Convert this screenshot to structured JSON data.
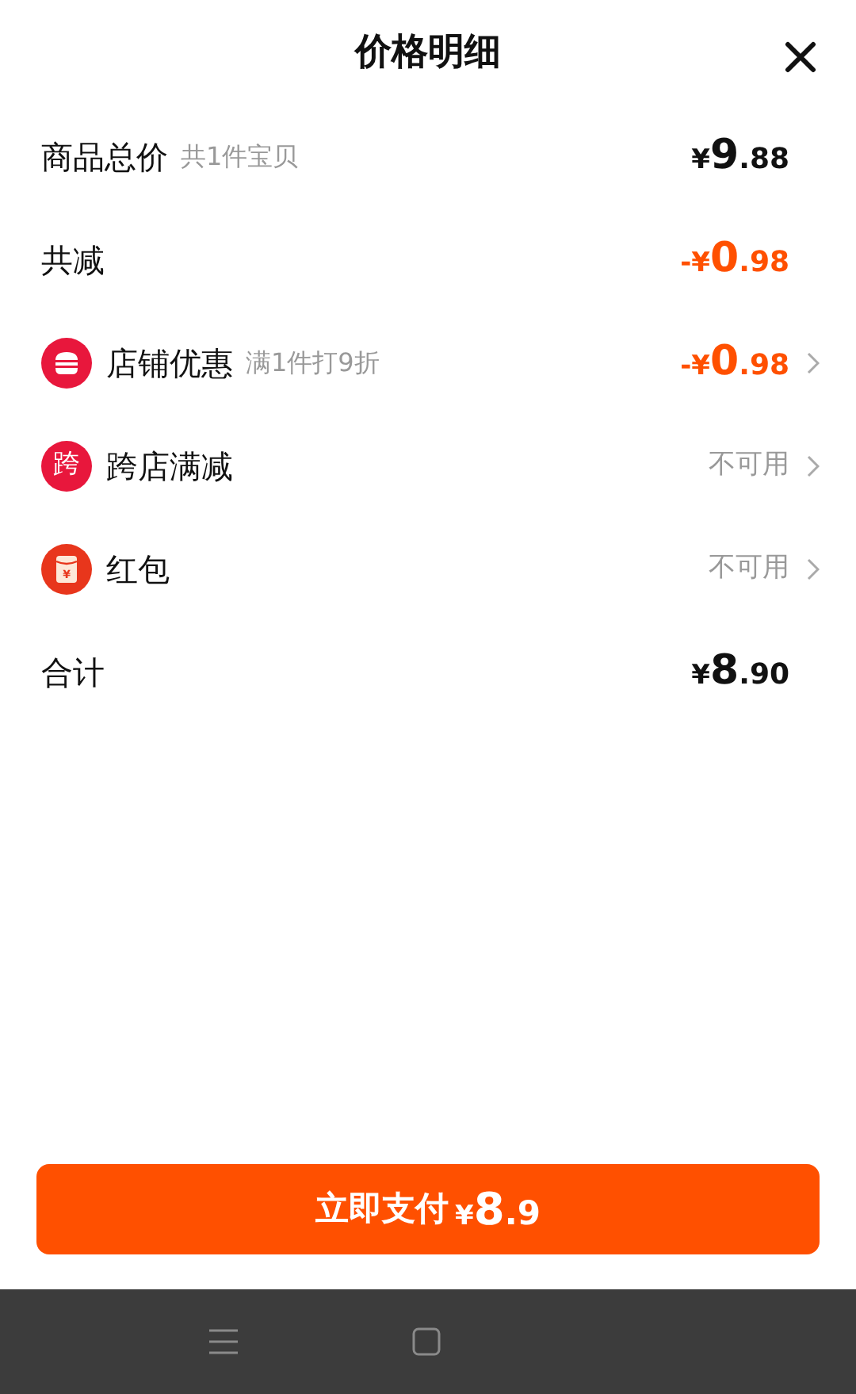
{
  "header": {
    "title": "价格明细"
  },
  "rows": [
    {
      "kind": "plain",
      "label": "商品总价",
      "note": "共1件宝贝",
      "amount": {
        "prefix": "¥",
        "main": "9",
        "fraction": ".88",
        "color": "#111111"
      }
    },
    {
      "kind": "plain",
      "label": "共减",
      "amount": {
        "prefix": "-¥",
        "main": "0",
        "fraction": ".98",
        "color": "#ff5000"
      }
    },
    {
      "kind": "store",
      "label": "店铺优惠",
      "note": "满1件打9折",
      "amount": {
        "prefix": "-¥",
        "main": "0",
        "fraction": ".98",
        "color": "#ff5000"
      },
      "chevron": true
    },
    {
      "kind": "cross",
      "icon_text": "跨",
      "label": "跨店满减",
      "status": "不可用",
      "chevron": true
    },
    {
      "kind": "envelope",
      "icon_text": "¥",
      "label": "红包",
      "status": "不可用",
      "chevron": true
    },
    {
      "kind": "plain",
      "label": "合计",
      "amount": {
        "prefix": "¥",
        "main": "8",
        "fraction": ".90",
        "color": "#111111"
      }
    }
  ],
  "pay_button": {
    "label": "立即支付",
    "prefix": "¥",
    "main": "8",
    "fraction": ".9"
  }
}
